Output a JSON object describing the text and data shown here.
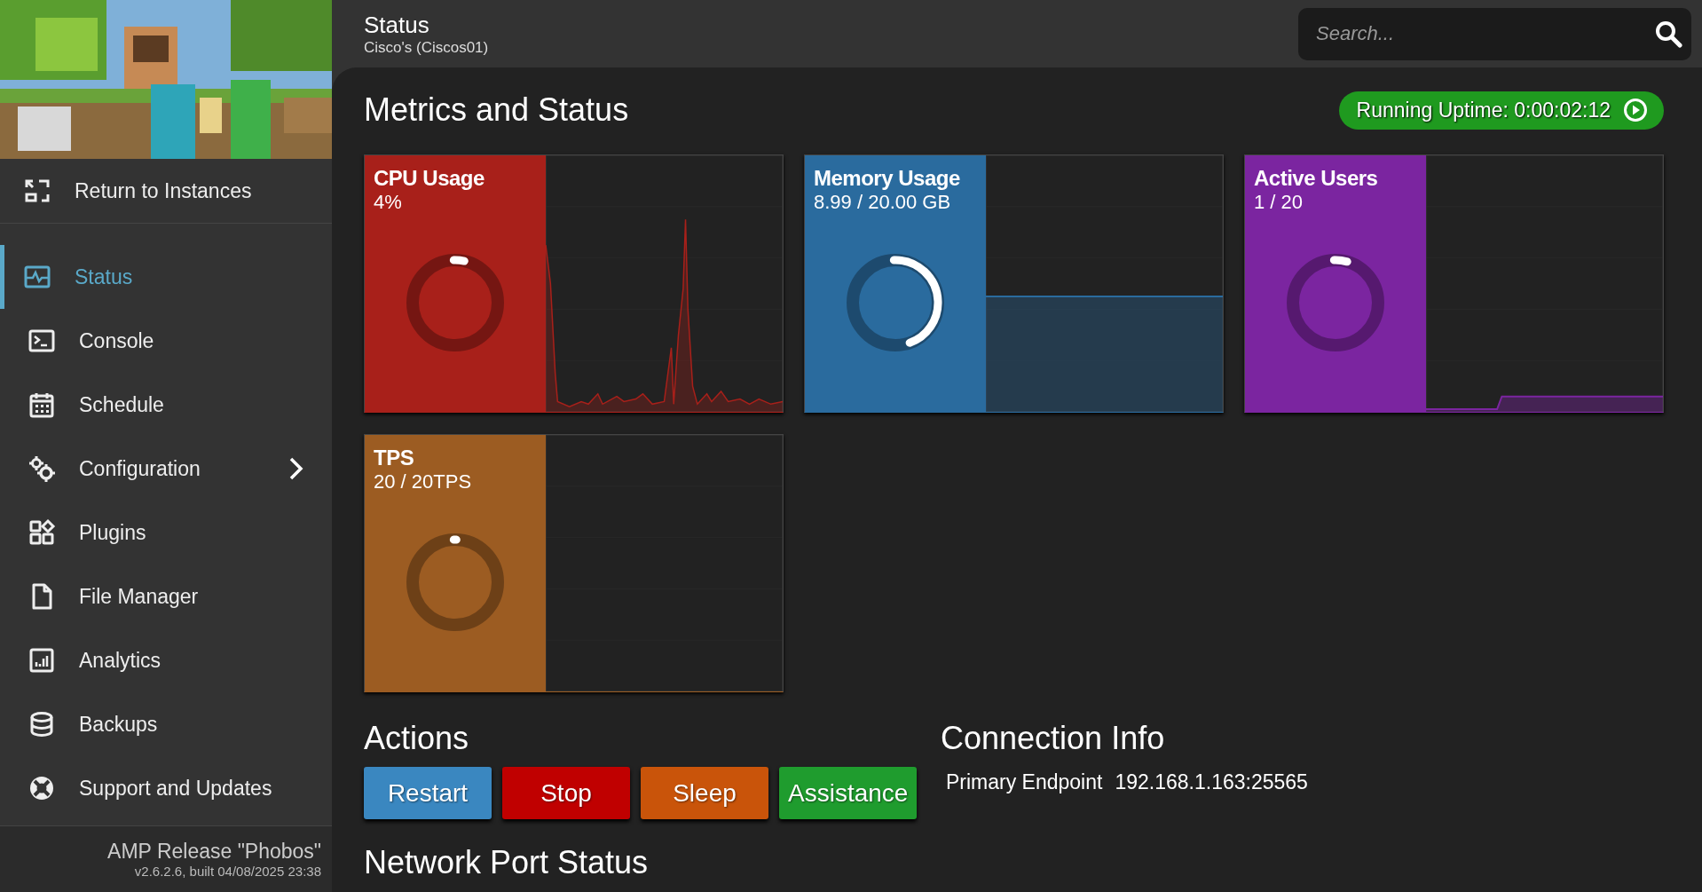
{
  "sidebar": {
    "return_link": "Return to Instances",
    "items": [
      {
        "label": "Status",
        "selected": true,
        "expandable": false
      },
      {
        "label": "Console",
        "selected": false,
        "expandable": false
      },
      {
        "label": "Schedule",
        "selected": false,
        "expandable": false
      },
      {
        "label": "Configuration",
        "selected": false,
        "expandable": true
      },
      {
        "label": "Plugins",
        "selected": false,
        "expandable": false
      },
      {
        "label": "File Manager",
        "selected": false,
        "expandable": false
      },
      {
        "label": "Analytics",
        "selected": false,
        "expandable": false
      },
      {
        "label": "Backups",
        "selected": false,
        "expandable": false
      },
      {
        "label": "Support and Updates",
        "selected": false,
        "expandable": false
      }
    ],
    "footer": {
      "release": "AMP Release \"Phobos\"",
      "version": "v2.6.2.6, built 04/08/2025 23:38"
    }
  },
  "header": {
    "title": "Status",
    "subtitle": "Cisco's (Ciscos01)",
    "search": {
      "placeholder": "Search..."
    }
  },
  "metrics": {
    "title": "Metrics and Status",
    "uptime": "Running Uptime: 0:00:02:12",
    "cards": [
      {
        "title": "CPU Usage",
        "value": "4%",
        "color": "#a8201a",
        "level": 0.04
      },
      {
        "title": "Memory Usage",
        "value": "8.99 / 20.00 GB",
        "color": "#2a6b9e",
        "level": 0.45
      },
      {
        "title": "Active Users",
        "value": "1 / 20",
        "color": "#7b25a0",
        "level": 0.05
      },
      {
        "title": "TPS",
        "value": "20 / 20TPS",
        "color": "#9c5c22",
        "level": 0.01
      }
    ]
  },
  "actions": {
    "title": "Actions",
    "buttons": [
      {
        "label": "Restart",
        "color": "#3a87c0"
      },
      {
        "label": "Stop",
        "color": "#c00000"
      },
      {
        "label": "Sleep",
        "color": "#c9540a"
      },
      {
        "label": "Assistance",
        "color": "#1f9c2e"
      }
    ]
  },
  "connection": {
    "title": "Connection Info",
    "label": "Primary Endpoint",
    "value": "192.168.1.163:25565"
  },
  "network": {
    "title": "Network Port Status"
  }
}
